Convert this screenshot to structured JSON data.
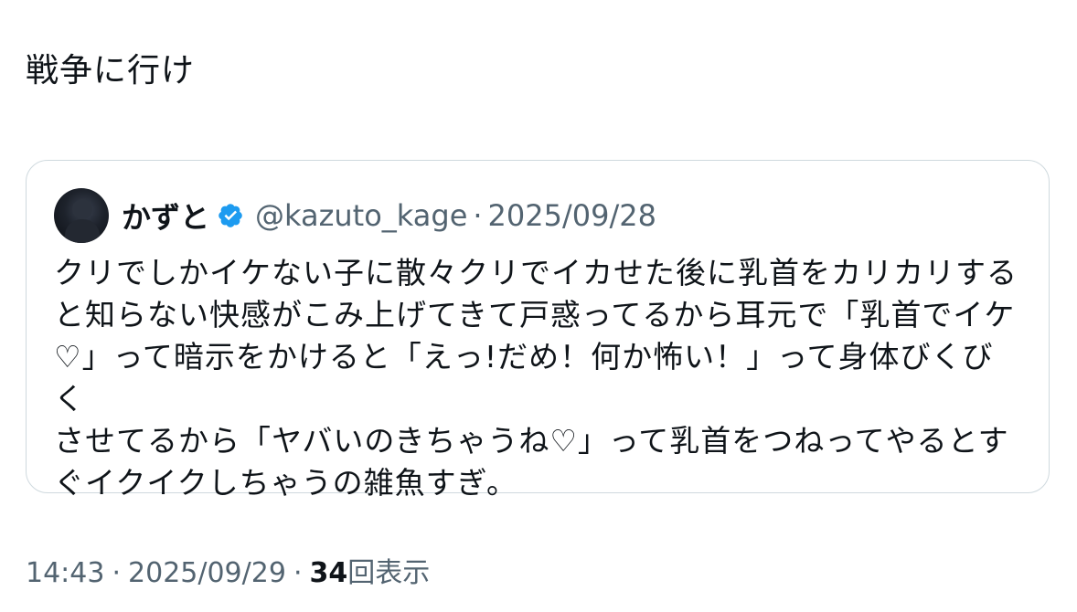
{
  "post": {
    "text": "戦争に行け",
    "time": "14:43",
    "date": "2025/09/29",
    "separator": "·",
    "views_count": "34",
    "views_label": "回表示"
  },
  "quoted_post": {
    "display_name": "かずと",
    "verified": true,
    "verified_icon": "verified-badge-icon",
    "handle": "@kazuto_kage",
    "separator": "·",
    "date": "2025/09/28",
    "body": "クリでしかイケない子に散々クリでイカせた後に乳首をカリカリする\nと知らない快感がこみ上げてきて戸惑ってるから耳元で「乳首でイケ\n♡」って暗示をかけると「えっ!だめ！何か怖い！」って身体びくびく\nさせてるから「ヤバいのきちゃうね♡」って乳首をつねってやるとす\nぐイクイクしちゃうの雑魚すぎ。"
  },
  "colors": {
    "text_primary": "#0f1419",
    "text_secondary": "#536471",
    "border": "#cfd9de",
    "verified_blue": "#1d9bf0"
  }
}
